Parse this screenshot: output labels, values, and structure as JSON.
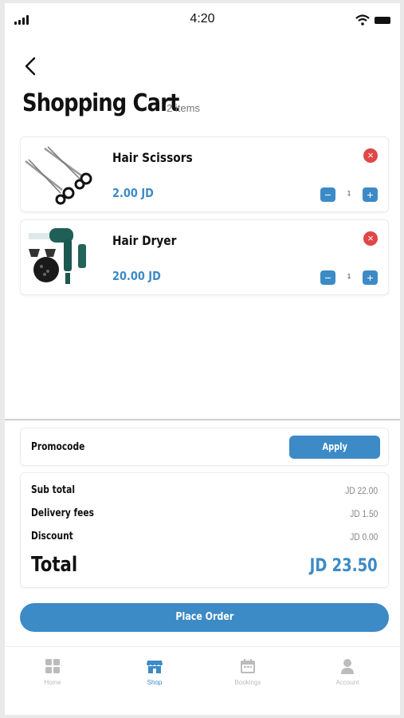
{
  "status_bar": {
    "time": "4:20"
  },
  "header": {
    "title": "Shopping Cart",
    "item_count": "2 items"
  },
  "cart_items": [
    {
      "name": "Hair Scissors",
      "price": "2.00 JD",
      "quantity": "1"
    },
    {
      "name": "Hair Dryer",
      "price": "20.00 JD",
      "quantity": "1"
    }
  ],
  "promo": {
    "label": "Promocode",
    "apply_label": "Apply"
  },
  "summary": {
    "subtotal_label": "Sub total",
    "subtotal_value": "JD 22.00",
    "delivery_label": "Delivery fees",
    "delivery_value": "JD 1.50",
    "discount_label": "Discount",
    "discount_value": "JD 0.00",
    "total_label": "Total",
    "total_value": "JD 23.50"
  },
  "place_order_label": "Place Order",
  "tabs": [
    {
      "label": "Home",
      "icon": "grid-icon"
    },
    {
      "label": "Shop",
      "icon": "store-icon"
    },
    {
      "label": "Bookings",
      "icon": "calendar-icon"
    },
    {
      "label": "Account",
      "icon": "person-icon"
    }
  ],
  "colors": {
    "accent": "#3c8ac6",
    "danger": "#e04747",
    "inactive": "#bcbcbc"
  }
}
